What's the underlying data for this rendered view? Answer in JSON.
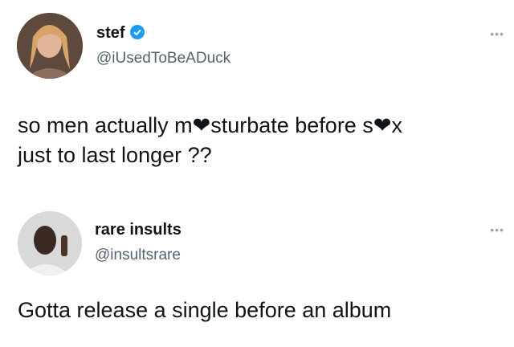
{
  "tweets": [
    {
      "display_name": "stef",
      "verified": true,
      "handle": "@iUsedToBeADuck",
      "text_line1": "so men actually m❤sturbate before s❤x",
      "text_line2": "just to last longer ??",
      "more_icon": "ellipsis-icon"
    },
    {
      "display_name": "rare insults",
      "verified": false,
      "handle": "@insultsrare",
      "text_line1": "Gotta release a single before an album",
      "more_icon": "ellipsis-icon"
    }
  ],
  "colors": {
    "text": "#0f1419",
    "secondary": "#536471",
    "verified": "#1d9bf0"
  }
}
